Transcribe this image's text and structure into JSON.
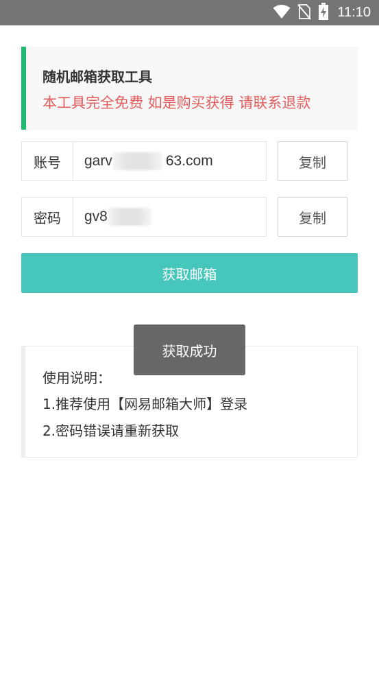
{
  "status_bar": {
    "time": "11:10",
    "icons": [
      "wifi-icon",
      "no-sim-icon",
      "battery-charging-icon"
    ]
  },
  "notice": {
    "title": "随机邮箱获取工具",
    "warning": "本工具完全免费 如是购买获得 请联系退款",
    "accent_color": "#1fbb71",
    "warning_color": "#e35d5d"
  },
  "account": {
    "label": "账号",
    "value_start": "garv",
    "value_end": "63.com",
    "copy_label": "复制"
  },
  "password": {
    "label": "密码",
    "value_start": "gv8",
    "copy_label": "复制"
  },
  "get_email_button": {
    "label": "获取邮箱",
    "color": "#47c6bb"
  },
  "instructions": {
    "heading": "使用说明：",
    "items": [
      "1.推荐使用【网易邮箱大师】登录",
      "2.密码错误请重新获取"
    ]
  },
  "toast": {
    "message": "获取成功"
  }
}
